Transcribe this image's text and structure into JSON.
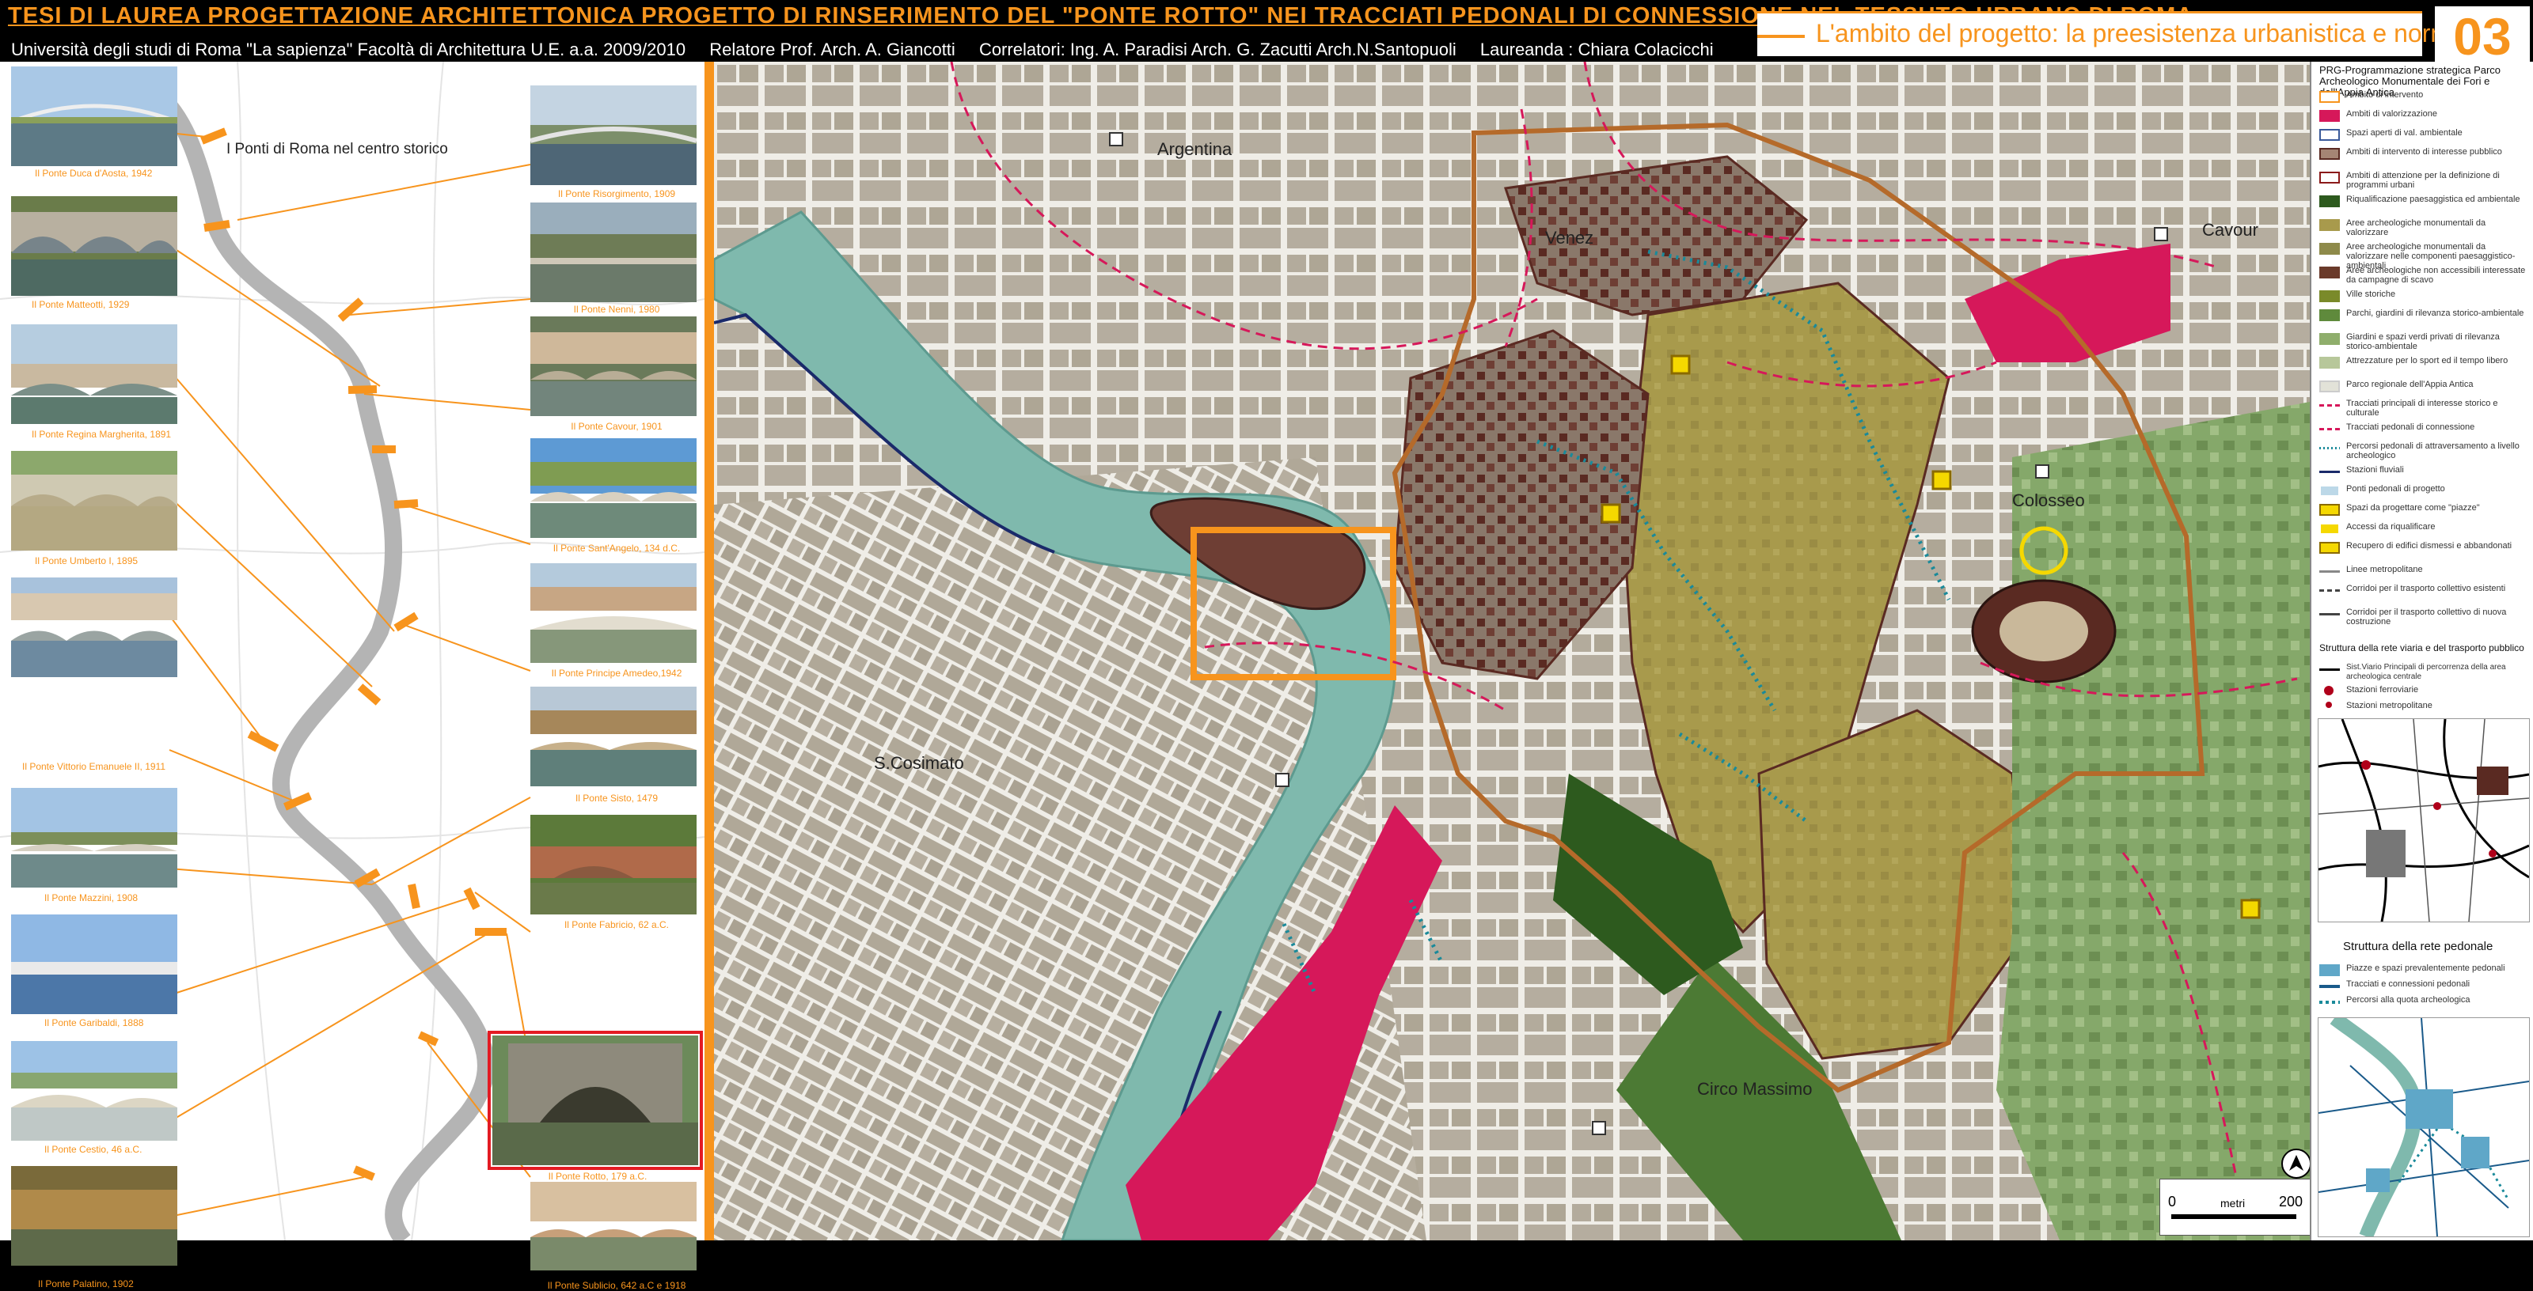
{
  "header": {
    "title": "TESI DI LAUREA   PROGETTAZIONE ARCHITETTONICA   PROGETTO DI RINSERIMENTO DEL \"PONTE ROTTO\" NEI TRACCIATI PEDONALI DI CONNESSIONE NEL TESSUTO URBANO DI ROMA",
    "section_title": "L'ambito del progetto: la preesistenza urbanistica e normativa",
    "sheet_number": "03"
  },
  "credits": {
    "university": "Università degli studi di Roma \"La sapienza\" Facoltà di Architettura U.E. a.a. 2009/2010",
    "relatore": "Relatore Prof. Arch. A. Giancotti",
    "correlatori": "Correlatori:   Ing. A. Paradisi   Arch. G. Zacutti   Arch.N.Santopuoli",
    "laureanda": "Laureanda : Chiara Colacicchi"
  },
  "left_panel": {
    "title": "I Ponti di Roma nel centro storico",
    "bridges_left": [
      "Il Ponte Duca d'Aosta, 1942",
      "Il Ponte Matteotti, 1929",
      "Il Ponte Regina Margherita, 1891",
      "Il Ponte Umberto I, 1895",
      "Il Ponte Vittorio Emanuele II, 1911",
      "Il Ponte Mazzini, 1908",
      "Il Ponte Garibaldi, 1888",
      "Il Ponte Cestio, 46 a.C.",
      "Il Ponte Palatino, 1902"
    ],
    "bridges_right": [
      "Il Ponte Risorgimento, 1909",
      "Il Ponte Nenni, 1980",
      "Il Ponte Cavour, 1901",
      "Il Ponte Sant'Angelo, 134 d.C.",
      "Il Ponte Principe Amedeo,1942",
      "Il Ponte Sisto, 1479",
      "Il Ponte Fabricio, 62 a.C.",
      "Il Ponte Rotto, 179 a.C.",
      "Il Ponte Sublicio, 642 a.C e 1918"
    ]
  },
  "map": {
    "labels": {
      "argentina": "Argentina",
      "venezia": "Venez",
      "cavour": "Cavour",
      "colosseo": "Colosseo",
      "cosimato": "S.Cosimato",
      "circo": "Circo Massimo"
    },
    "scale": {
      "zero": "0",
      "unit": "metri",
      "max": "200"
    },
    "colors": {
      "tiber": "#7fb9ad",
      "block": "#b3ab9c",
      "street": "#efede7",
      "orange": "#f7941d",
      "magenta": "#d6185a",
      "archeo_brown": "#5a2a22",
      "olive": "#a89a4c",
      "green_dark": "#3e6a2c",
      "green_light": "#85a86a"
    }
  },
  "legend": {
    "heading": "PRG-Programmazione strategica Parco Archeologico Monumentale dei Fori e dell'Appia Antica",
    "items": [
      {
        "label": "Ambito di intervento",
        "color": "#ffffff",
        "border": "#f7941d"
      },
      {
        "label": "Ambiti di valorizzazione",
        "color": "#d6185a",
        "border": "#d6185a"
      },
      {
        "label": "Spazi aperti di val. ambientale",
        "color": "#ffffff",
        "border": "#3a5a9a"
      },
      {
        "label": "Ambiti di intervento di interesse pubblico",
        "color": "#a58574",
        "border": "#5a2a22"
      },
      {
        "label": "Ambiti di attenzione per la definizione di programmi urbani",
        "color": "#ffffff",
        "border": "#8b1a1a"
      },
      {
        "label": "Riqualificazione paesaggistica ed ambientale",
        "color": "#2d5a1e",
        "border": "#2d5a1e"
      },
      {
        "label": "Aree archeologiche monumentali da valorizzare",
        "color": "#a89a4c",
        "border": "#a89a4c"
      },
      {
        "label": "Aree archeologiche monumentali da valorizzare nelle componenti paesaggistico-ambientali",
        "color": "#8e8a4a",
        "border": "#8e8a4a"
      },
      {
        "label": "Aree archeologiche non accessibili interessate da campagne di scavo",
        "color": "#6a3a2a",
        "border": "#6a3a2a"
      },
      {
        "label": "Ville storiche",
        "color": "#7a8a2a",
        "border": "#7a8a2a"
      },
      {
        "label": "Parchi, giardini di rilevanza storico-ambientale",
        "color": "#5f8a3c",
        "border": "#5f8a3c"
      },
      {
        "label": "Giardini e spazi verdi privati di rilevanza storico-ambientale",
        "color": "#8fae6c",
        "border": "#8fae6c"
      },
      {
        "label": "Attrezzature per lo sport ed il tempo libero",
        "color": "#b7c79a",
        "border": "#b7c79a"
      },
      {
        "label": "Parco regionale dell'Appia Antica",
        "color": "#e2e2d8",
        "border": "#cccccc"
      },
      {
        "label": "Tracciati principali di interesse storico e culturale",
        "color": "#d6185a",
        "border": "#ffffff"
      },
      {
        "label": "Tracciati pedonali di connessione",
        "color": "#d6185a",
        "border": "#ffffff"
      },
      {
        "label": "Percorsi pedonali di attraversamento a livello archeologico",
        "color": "#1a8a9a",
        "border": "#ffffff"
      },
      {
        "label": "Stazioni fluviali",
        "color": "#1a2a6a",
        "border": "#ffffff"
      },
      {
        "label": "Ponti pedonali di progetto",
        "color": "#bcd8e8",
        "border": "#ffffff"
      },
      {
        "label": "Spazi da progettare come \"piazze\"",
        "color": "#f5d800",
        "border": "#8a6a00"
      },
      {
        "label": "Accessi da riqualificare",
        "color": "#f5d800",
        "border": "#ffffff"
      },
      {
        "label": "Recupero di edifici dismessi e abbandonati",
        "color": "#f5d800",
        "border": "#8a6a00"
      },
      {
        "label": "Linee metropolitane",
        "color": "#888888",
        "border": "#ffffff"
      },
      {
        "label": "Corridoi per il trasporto collettivo esistenti",
        "color": "#444444",
        "border": "#ffffff"
      },
      {
        "label": "Corridoi per il trasporto collettivo di nuova costruzione",
        "color": "#444444",
        "border": "#ffffff"
      }
    ],
    "struttura_viaria_title": "Struttura della rete viaria e del trasporto pubblico",
    "viaria_items": [
      "Sist.Viario Principali di percorrenza della area archeologica centrale",
      "Stazioni ferroviarie",
      "Stazioni metropolitane"
    ],
    "struttura_pedonale_title": "Struttura della rete pedonale",
    "pedonale_items": [
      "Piazze e spazi prevalentemente pedonali",
      "Tracciati e connessioni pedonali",
      "Percorsi alla quota archeologica"
    ]
  }
}
